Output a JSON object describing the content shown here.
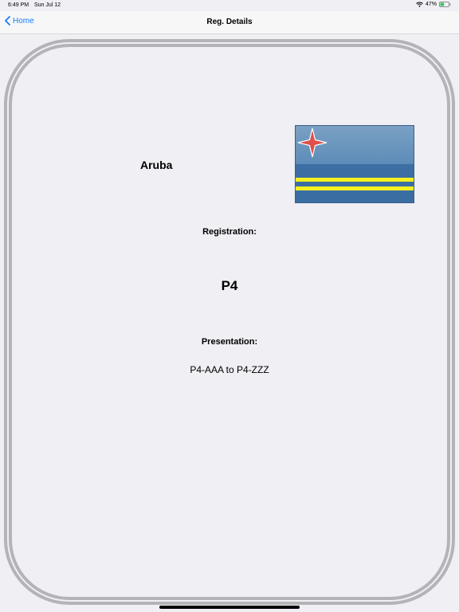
{
  "status_bar": {
    "time": "6:49 PM",
    "date": "Sun Jul 12",
    "battery_percent": "47%",
    "battery_level": 0.47,
    "battery_color": "#34c759"
  },
  "nav": {
    "back_label": "Home",
    "title": "Reg. Details",
    "accent_color": "#157efb"
  },
  "details": {
    "country": "Aruba",
    "registration_label": "Registration:",
    "registration_code": "P4",
    "presentation_label": "Presentation:",
    "presentation_value": "P4-AAA to P4-ZZZ",
    "flag_icon": "aruba-flag-icon"
  }
}
